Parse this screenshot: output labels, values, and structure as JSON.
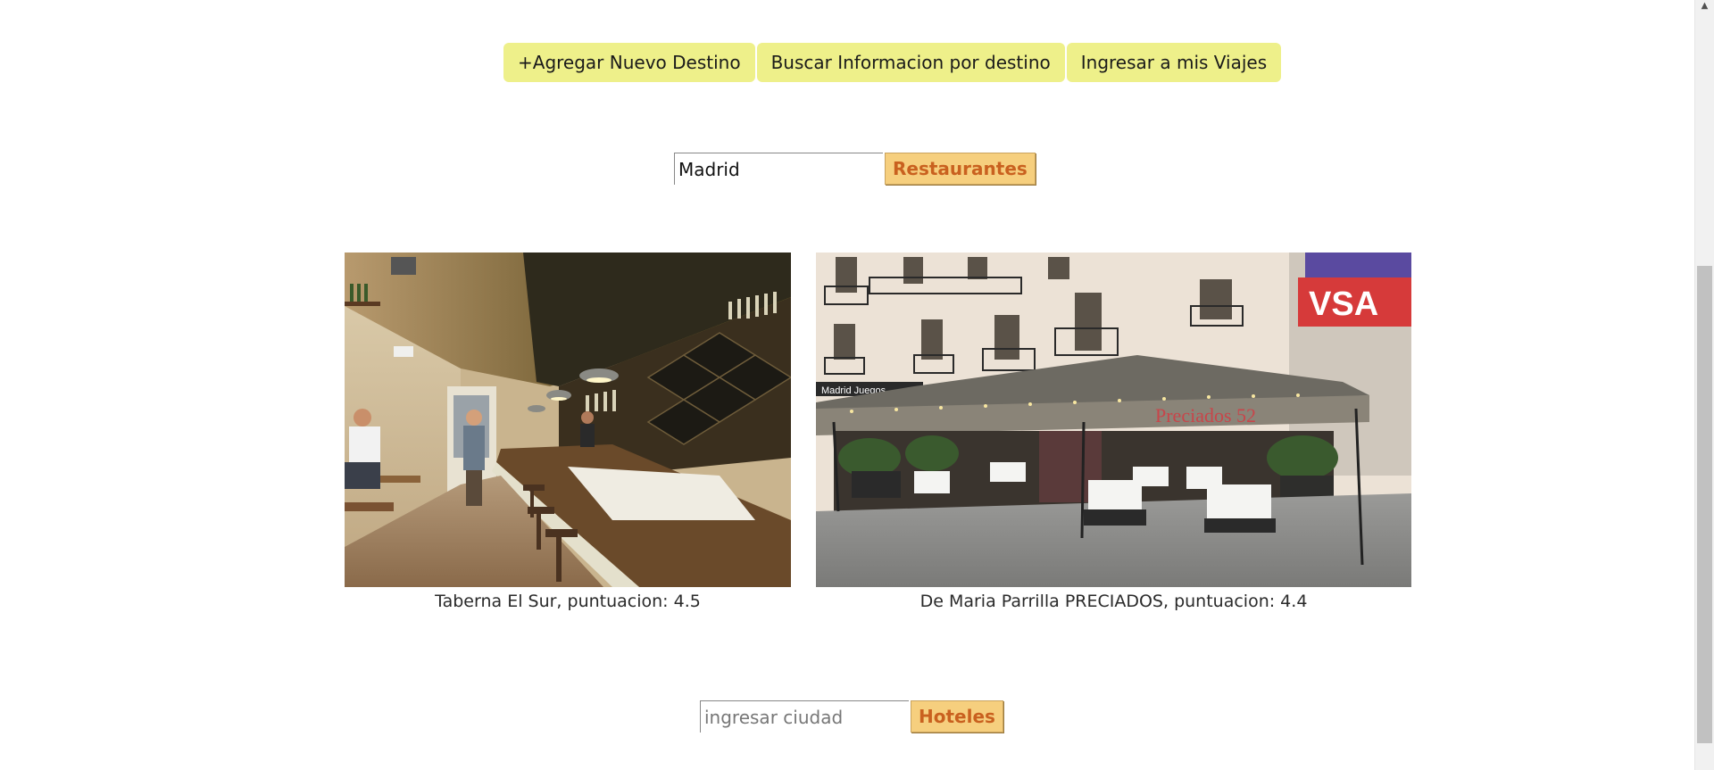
{
  "nav": {
    "add_destination": "+Agregar Nuevo Destino",
    "search_info": "Buscar Informacion por destino",
    "my_trips": "Ingresar a mis Viajes"
  },
  "restaurant_search": {
    "value": "Madrid",
    "button_label": "Restaurantes"
  },
  "restaurants": [
    {
      "caption": "Taberna El Sur, puntuacion: 4.5"
    },
    {
      "caption": "De Maria Parrilla PRECIADOS, puntuacion: 4.4"
    }
  ],
  "hotel_search": {
    "placeholder": "ingresar ciudad",
    "button_label": "Hoteles"
  },
  "photo_text": {
    "sign_vsa": "VSA",
    "sign_madrid_juegos": "Madrid Juegos",
    "awning_text": "Preciados 52"
  },
  "colors": {
    "nav_button_bg": "#eef08a",
    "search_button_bg": "#f6cf7e",
    "search_button_text": "#c9611f"
  }
}
